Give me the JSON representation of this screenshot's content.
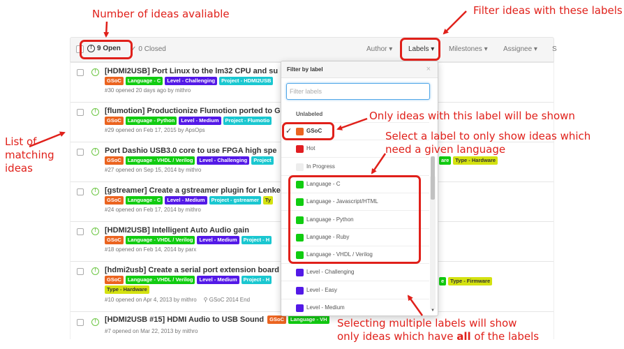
{
  "annotations": {
    "count": "Number of ideas avaliable",
    "filter": "Filter ideas with these labels",
    "list": "List of\nmatching\nideas",
    "only": "Only ideas with this label will be shown",
    "select": "Select a label to only show ideas which\nneed a given language",
    "multi1": "Selecting multiple labels will show",
    "multi2_pre": "only ideas which have ",
    "multi2_bold": "all",
    "multi2_post": " of the labels"
  },
  "header": {
    "open": "9 Open",
    "closed": "0 Closed",
    "filters": [
      "Author ▾",
      "Labels ▾",
      "Milestones ▾",
      "Assignee ▾",
      "S"
    ]
  },
  "colors": {
    "gsoc": "#eb6420",
    "hot": "#e11d21",
    "in_progress": "#ededed",
    "language": "#11cc11",
    "level": "#5319e7",
    "project": "#1ac7d0",
    "type": "#d4e210",
    "annotation": "#e0201a"
  },
  "issues": [
    {
      "title": "[HDMI2USB] Port Linux to the lm32 CPU and su",
      "labels": [
        [
          "GSoC",
          "gsoc"
        ],
        [
          "Language - C",
          "language"
        ],
        [
          "Level - Challenging",
          "level"
        ],
        [
          "Project - HDMI2USB",
          "project"
        ]
      ],
      "right_labels": [],
      "meta": "#30 opened 20 days ago by mithro"
    },
    {
      "title": "[flumotion] Productionize Flumotion ported to G",
      "labels": [
        [
          "GSoC",
          "gsoc"
        ],
        [
          "Language - Python",
          "language"
        ],
        [
          "Level - Medium",
          "level"
        ],
        [
          "Project - Flumotio",
          "project"
        ]
      ],
      "right_labels": [],
      "meta": "#29 opened on Feb 17, 2015 by ApsOps"
    },
    {
      "title": "Port Dashio USB3.0 core to use FPGA high spe",
      "labels": [
        [
          "GSoC",
          "gsoc"
        ],
        [
          "Language - VHDL / Verilog",
          "language"
        ],
        [
          "Level - Challenging",
          "level"
        ],
        [
          "Project",
          "project"
        ]
      ],
      "right_labels": [
        [
          "are",
          "language"
        ],
        [
          "Type - Hardware",
          "type"
        ]
      ],
      "meta": "#27 opened on Sep 15, 2014 by mithro"
    },
    {
      "title": "[gstreamer] Create a gstreamer plugin for Lenke",
      "labels": [
        [
          "GSoC",
          "gsoc"
        ],
        [
          "Language - C",
          "language"
        ],
        [
          "Level - Medium",
          "level"
        ],
        [
          "Project - gstreamer",
          "project"
        ],
        [
          "Ty",
          "type"
        ]
      ],
      "right_labels": [],
      "meta": "#24 opened on Feb 17, 2014 by mithro"
    },
    {
      "title": "[HDMI2USB] Intelligent Auto Audio gain",
      "labels": [
        [
          "GSoC",
          "gsoc"
        ],
        [
          "Language - VHDL / Verilog",
          "language"
        ],
        [
          "Level - Medium",
          "level"
        ],
        [
          "Project - H",
          "project"
        ]
      ],
      "right_labels": [],
      "meta": "#18 opened on Feb 14, 2014 by parx"
    },
    {
      "title": "[hdmi2usb] Create a serial port extension board",
      "labels": [
        [
          "GSoC",
          "gsoc"
        ],
        [
          "Language - VHDL / Verilog",
          "language"
        ],
        [
          "Level - Medium",
          "level"
        ],
        [
          "Project - H",
          "project"
        ]
      ],
      "labels2": [
        [
          "Type - Hardware",
          "type"
        ]
      ],
      "right_labels": [
        [
          "e",
          "language"
        ],
        [
          "Type - Firmware",
          "type"
        ]
      ],
      "meta": "#10 opened on Apr 4, 2013 by mithro",
      "milestone": "GSoC 2014 End"
    },
    {
      "title": "[HDMI2USB #15] HDMI Audio to USB Sound",
      "labels": [],
      "inline_labels": [
        [
          "GSoC",
          "gsoc"
        ],
        [
          "Language - VH",
          "language"
        ]
      ],
      "right_labels": [],
      "meta": "#7 opened on Mar 22, 2013 by mithro"
    }
  ],
  "dropdown": {
    "title": "Filter by label",
    "close": "×",
    "placeholder": "Filter labels",
    "unlabeled": "Unlabeled",
    "items": [
      {
        "name": "GSoC",
        "color": "gsoc",
        "checked": true
      },
      {
        "name": "Hot",
        "color": "hot",
        "checked": false
      },
      {
        "name": "In Progress",
        "color": "in_progress",
        "checked": false
      },
      {
        "name": "Language - C",
        "color": "language",
        "checked": false
      },
      {
        "name": "Language - Javascript/HTML",
        "color": "language",
        "checked": false
      },
      {
        "name": "Language - Python",
        "color": "language",
        "checked": false
      },
      {
        "name": "Language - Ruby",
        "color": "language",
        "checked": false
      },
      {
        "name": "Language - VHDL / Verilog",
        "color": "language",
        "checked": false
      },
      {
        "name": "Level - Challenging",
        "color": "level",
        "checked": false
      },
      {
        "name": "Level - Easy",
        "color": "level",
        "checked": false
      },
      {
        "name": "Level - Medium",
        "color": "level",
        "checked": false
      }
    ]
  }
}
